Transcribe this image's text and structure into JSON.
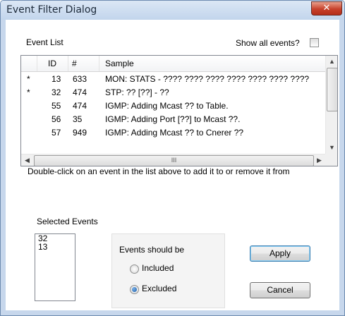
{
  "window": {
    "title": "Event Filter Dialog",
    "close_glyph": "✕"
  },
  "event_list": {
    "label": "Event List",
    "show_all_label": "Show all events?",
    "show_all_checked": false,
    "columns": [
      "",
      "ID",
      "#",
      "Sample"
    ],
    "rows": [
      {
        "mark": "*",
        "id": "13",
        "count": "633",
        "sample": "MON: STATS - ???? ???? ???? ???? ???? ???? ????"
      },
      {
        "mark": "*",
        "id": "32",
        "count": "474",
        "sample": "STP: ?? [??] - ??"
      },
      {
        "mark": "",
        "id": "55",
        "count": "474",
        "sample": "IGMP: Adding Mcast ?? to Table."
      },
      {
        "mark": "",
        "id": "56",
        "count": "35",
        "sample": "IGMP: Adding Port [??] to Mcast ??."
      },
      {
        "mark": "",
        "id": "57",
        "count": "949",
        "sample": "IGMP: Adding Mcast ?? to Cnerer ??"
      }
    ],
    "hscroll_glyph": "III"
  },
  "instruction": "Double-click on an event in the list above to add it to or remove it from",
  "selected_events": {
    "label": "Selected Events",
    "items": [
      "32",
      "13"
    ]
  },
  "mode": {
    "label": "Events should be",
    "options": [
      "Included",
      "Excluded"
    ],
    "selected": "Excluded"
  },
  "buttons": {
    "apply": "Apply",
    "cancel": "Cancel"
  }
}
